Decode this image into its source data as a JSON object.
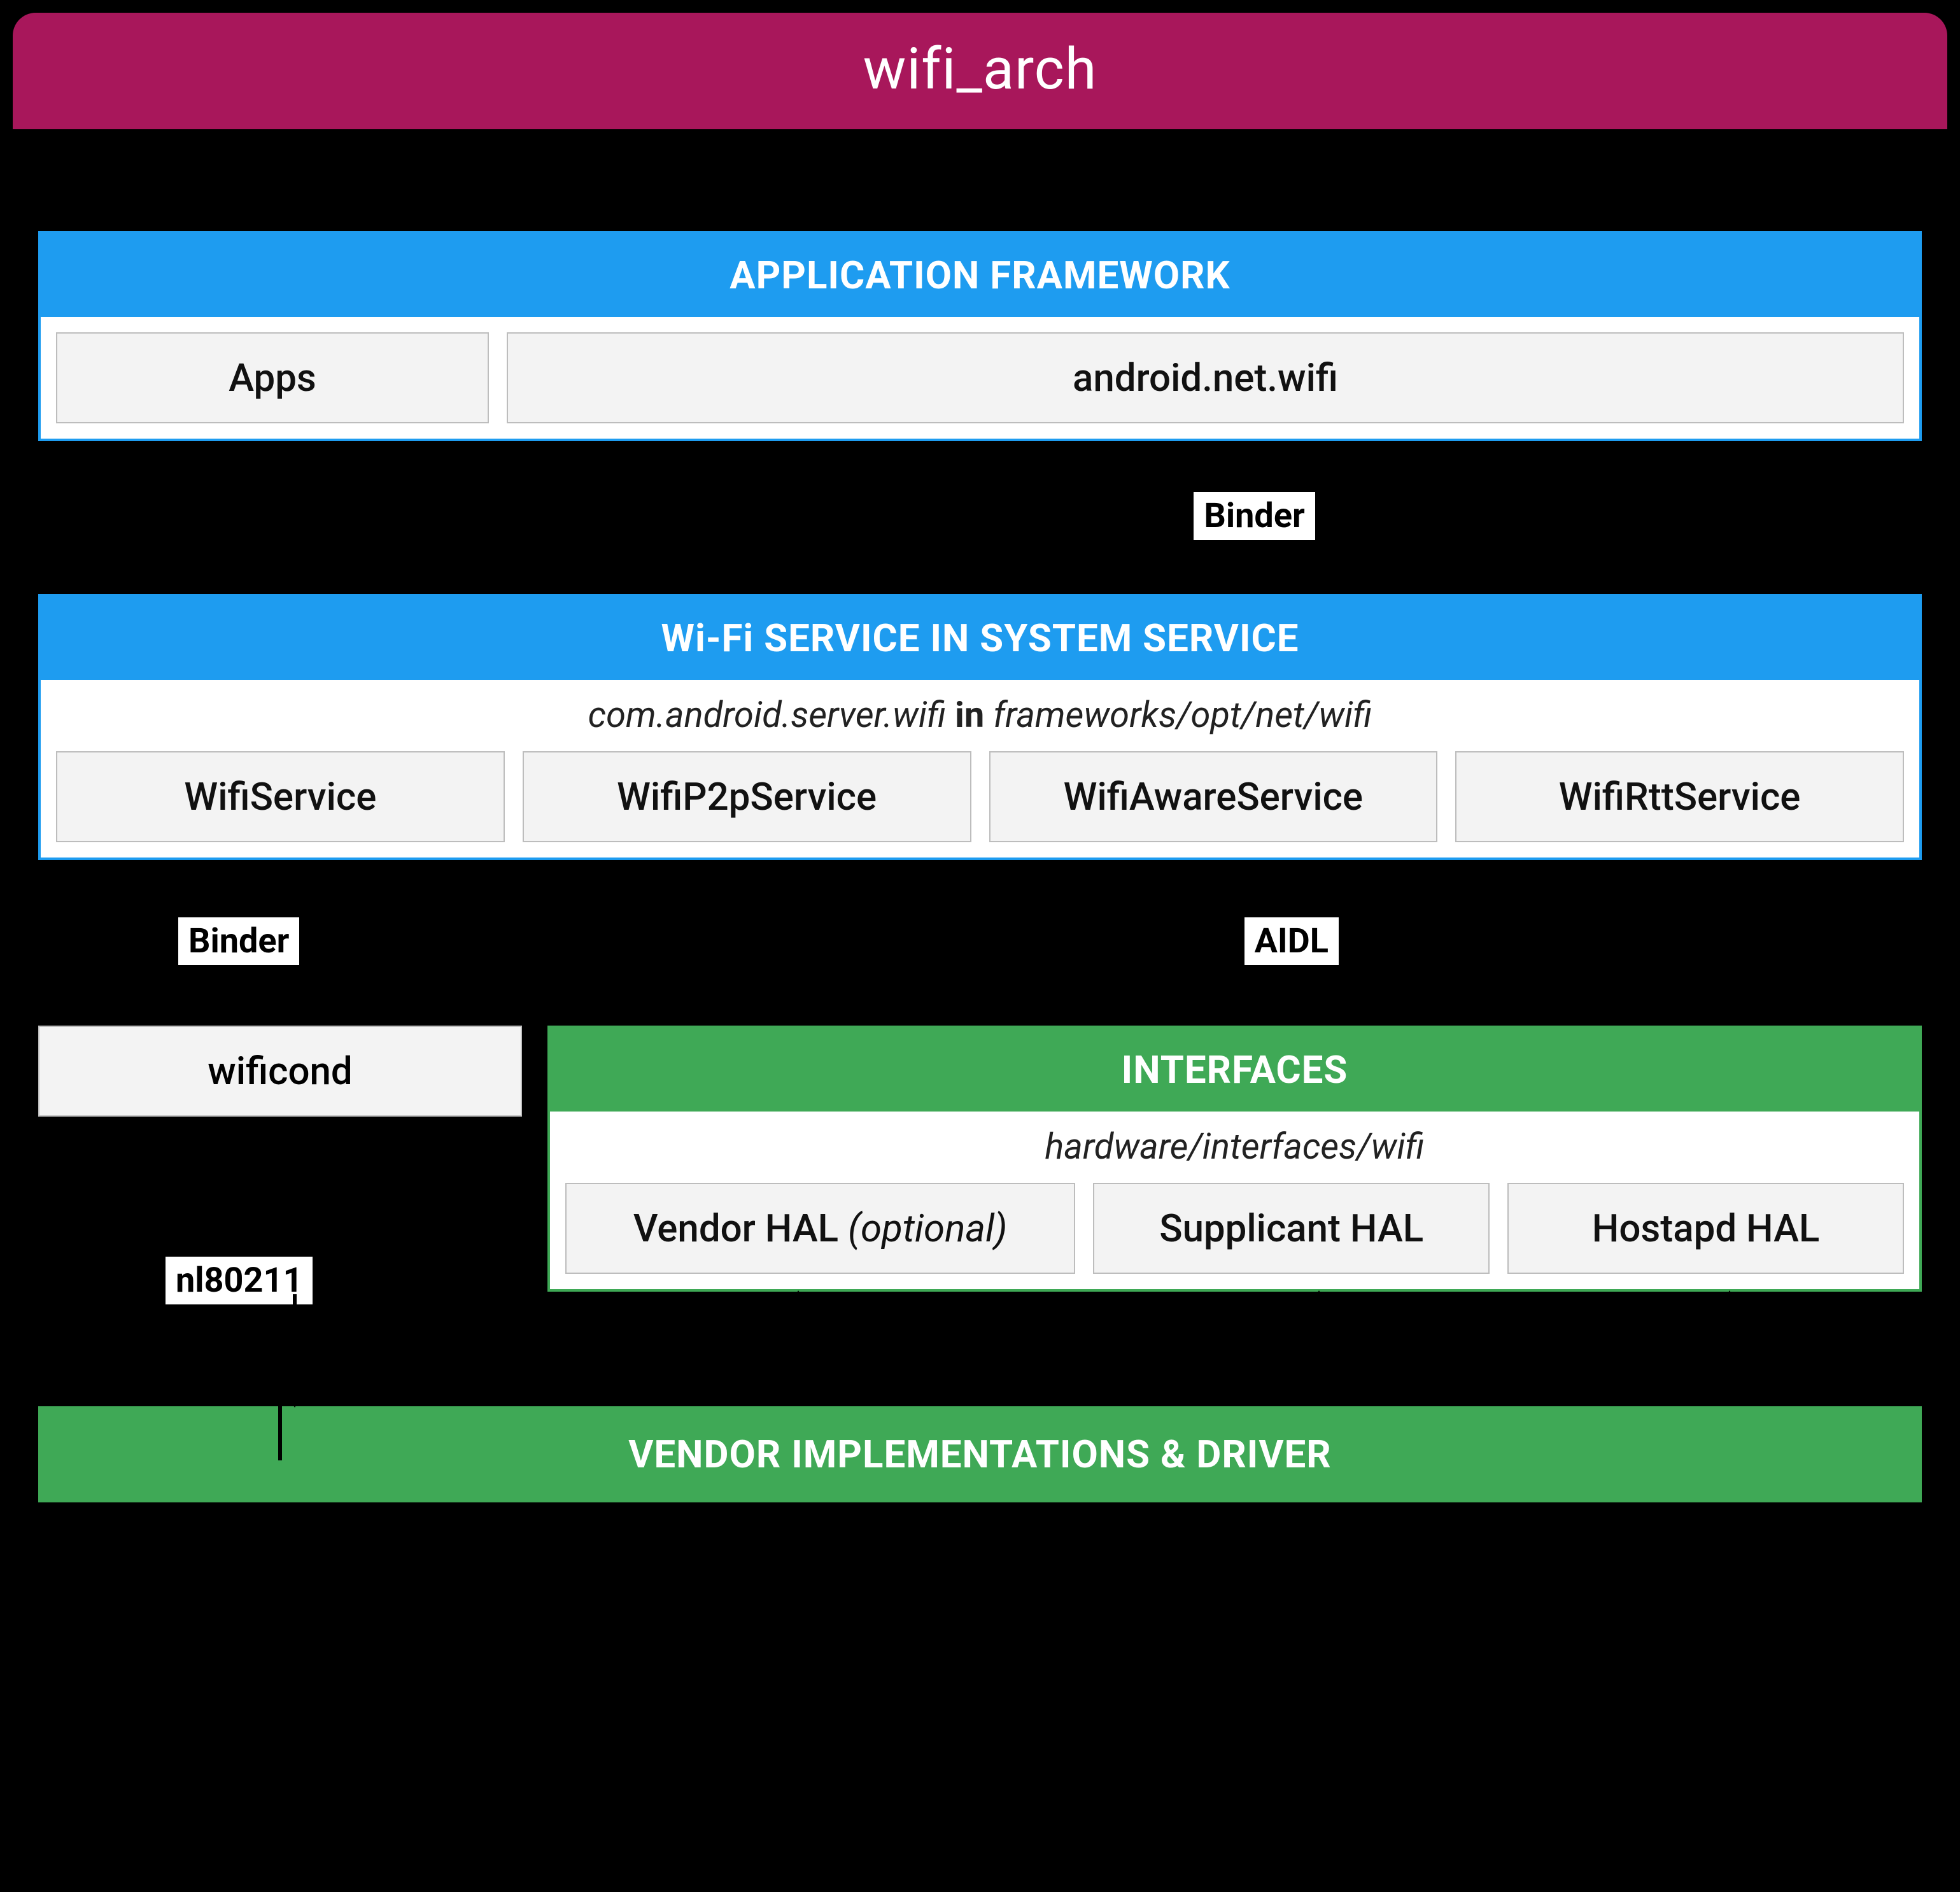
{
  "title": "wifi_arch",
  "app_framework": {
    "header": "APPLICATION FRAMEWORK",
    "cells": {
      "apps": "Apps",
      "netwifi": "android.net.wifi"
    }
  },
  "connectors": {
    "binder1": "Binder",
    "binder2": "Binder",
    "aidl": "AIDL",
    "nl80211": "nl80211"
  },
  "wifi_service": {
    "header": "Wi-Fi SERVICE IN SYSTEM SERVICE",
    "caption_pkg": "com.android.server.wifi",
    "caption_in": "in",
    "caption_path": "frameworks/opt/net/wifi",
    "cells": {
      "wifiservice": "WifiService",
      "wifip2p": "WifiP2pService",
      "wifiaware": "WifiAwareService",
      "wifirtt": "WifiRttService"
    }
  },
  "wificond": "wificond",
  "interfaces": {
    "header": "INTERFACES",
    "caption": "hardware/interfaces/wifi",
    "cells": {
      "vendorhal": "Vendor HAL",
      "vendorhal_opt": "(optional)",
      "supplicant": "Supplicant HAL",
      "hostapd": "Hostapd HAL"
    }
  },
  "vendor_bar": "VENDOR IMPLEMENTATIONS & DRIVER"
}
